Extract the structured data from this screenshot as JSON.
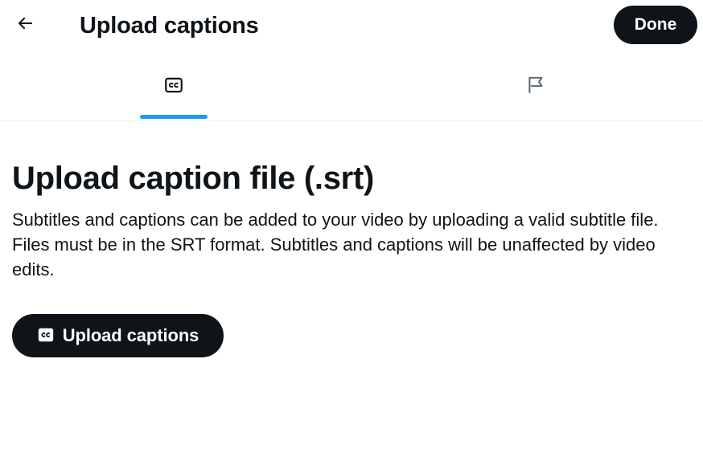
{
  "header": {
    "back_icon": "arrow-left-icon",
    "title": "Upload captions",
    "done_label": "Done"
  },
  "tabs": [
    {
      "icon": "closed-captions-icon",
      "active": true
    },
    {
      "icon": "flag-icon",
      "active": false
    }
  ],
  "main": {
    "heading": "Upload caption file (.srt)",
    "description": "Subtitles and captions can be added to your video by uploading a valid subtitle file. Files must be in the SRT format. Subtitles and captions will be unaffected by video edits.",
    "upload_button": {
      "icon": "closed-captions-icon",
      "label": "Upload captions"
    }
  },
  "colors": {
    "primary_text": "#0f1419",
    "button_background": "#0f1419",
    "button_text": "#ffffff",
    "active_tab_indicator": "#1d9bf0",
    "divider": "#eff3f4"
  }
}
